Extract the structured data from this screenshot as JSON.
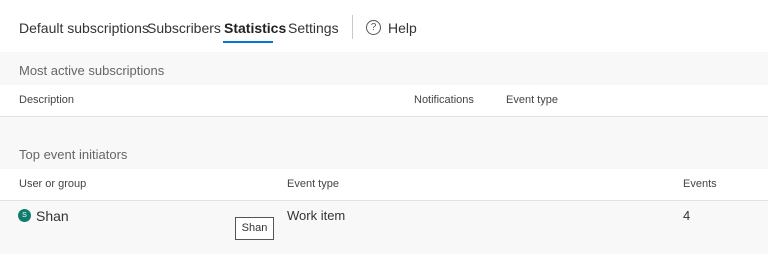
{
  "tabs": {
    "default_subscriptions": "Default subscriptions",
    "subscribers": "Subscribers",
    "statistics": "Statistics",
    "settings": "Settings",
    "help": "Help",
    "help_icon_glyph": "?"
  },
  "most_active": {
    "title": "Most active subscriptions",
    "columns": {
      "description": "Description",
      "notifications": "Notifications",
      "event_type": "Event type"
    }
  },
  "top_initiators": {
    "title": "Top event initiators",
    "columns": {
      "user_or_group": "User or group",
      "event_type": "Event type",
      "events": "Events"
    },
    "rows": [
      {
        "avatar_initial": "S",
        "user": "Shan",
        "event_type": "Work item",
        "events": "4"
      }
    ]
  },
  "tooltip": {
    "text": "Shan"
  },
  "colors": {
    "accent": "#0078d4",
    "avatar": "#107c6c"
  }
}
